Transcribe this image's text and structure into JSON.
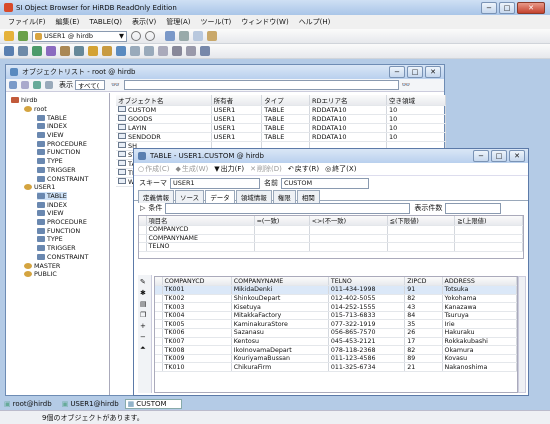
{
  "app": {
    "title": "SI Object Browser for HiRDB ReadOnly Edition"
  },
  "menu": [
    "ファイル(F)",
    "編集(E)",
    "TABLE(Q)",
    "表示(V)",
    "管理(A)",
    "ツール(T)",
    "ウィンドウ(W)",
    "ヘルプ(H)"
  ],
  "toolbar": {
    "connection": "USER1 @ hirdb"
  },
  "objwin": {
    "title": "オブジェクトリスト - root @ hirdb",
    "display_label": "表示",
    "display_value": "すべて(",
    "tree": [
      {
        "label": "hirdb",
        "level": 0,
        "kind": "db"
      },
      {
        "label": "root",
        "level": 1,
        "kind": "user"
      },
      {
        "label": "TABLE",
        "level": 2,
        "kind": "folder"
      },
      {
        "label": "INDEX",
        "level": 2,
        "kind": "folder"
      },
      {
        "label": "VIEW",
        "level": 2,
        "kind": "folder"
      },
      {
        "label": "PROCEDURE",
        "level": 2,
        "kind": "folder"
      },
      {
        "label": "FUNCTION",
        "level": 2,
        "kind": "folder"
      },
      {
        "label": "TYPE",
        "level": 2,
        "kind": "folder"
      },
      {
        "label": "TRIGGER",
        "level": 2,
        "kind": "folder"
      },
      {
        "label": "CONSTRAINT",
        "level": 2,
        "kind": "folder"
      },
      {
        "label": "USER1",
        "level": 1,
        "kind": "user"
      },
      {
        "label": "TABLE",
        "level": 2,
        "kind": "folder",
        "selected": true
      },
      {
        "label": "INDEX",
        "level": 2,
        "kind": "folder"
      },
      {
        "label": "VIEW",
        "level": 2,
        "kind": "folder"
      },
      {
        "label": "PROCEDURE",
        "level": 2,
        "kind": "folder"
      },
      {
        "label": "FUNCTION",
        "level": 2,
        "kind": "folder"
      },
      {
        "label": "TYPE",
        "level": 2,
        "kind": "folder"
      },
      {
        "label": "TRIGGER",
        "level": 2,
        "kind": "folder"
      },
      {
        "label": "CONSTRAINT",
        "level": 2,
        "kind": "folder"
      },
      {
        "label": "MASTER",
        "level": 1,
        "kind": "user"
      },
      {
        "label": "PUBLIC",
        "level": 1,
        "kind": "user"
      }
    ],
    "columns": [
      "オブジェクト名",
      "所有者",
      "タイプ",
      "RDエリア名",
      "空き領域"
    ],
    "rows": [
      [
        "CUSTOM",
        "USER1",
        "TABLE",
        "RDDATA10",
        "10"
      ],
      [
        "GOODS",
        "USER1",
        "TABLE",
        "RDDATA10",
        "10"
      ],
      [
        "LAYIN",
        "USER1",
        "TABLE",
        "RDDATA10",
        "10"
      ],
      [
        "SENDODR",
        "USER1",
        "TABLE",
        "RDDATA10",
        "10"
      ],
      [
        "SH",
        "",
        "",
        "",
        ""
      ],
      [
        "ST",
        "",
        "",
        "",
        ""
      ],
      [
        "TA",
        "",
        "",
        "",
        ""
      ],
      [
        "TE",
        "",
        "",
        "",
        ""
      ],
      [
        "WA",
        "",
        "",
        "",
        ""
      ]
    ]
  },
  "tablewin": {
    "title": "TABLE - USER1.CUSTOM @ hirdb",
    "tools": [
      "作成(C)",
      "生成(W)",
      "出力(F)",
      "削除(D)",
      "戻す(R)",
      "終了(X)"
    ],
    "schema_label": "スキーマ",
    "schema": "USER1",
    "name_label": "名前",
    "name": "CUSTOM",
    "tabs": [
      "定義情報",
      "ソース",
      "データ",
      "領域情報",
      "権限",
      "相関"
    ],
    "cond_label": "条件",
    "count_label": "表示件数",
    "filter_cols": [
      "項目名",
      "=(一致)",
      "<>(不一致)",
      "≦(下限値)",
      "≧(上限値)"
    ],
    "filter_rows": [
      "COMPANYCD",
      "COMPANYNAME",
      "TELNO"
    ],
    "data_cols": [
      "COMPANYCD",
      "COMPANYNAME",
      "TELNO",
      "ZIPCD",
      "ADDRESS"
    ],
    "data_rows": [
      [
        "TK001",
        "MikidaDenki",
        "011-434-1998",
        "91",
        "Totsuka"
      ],
      [
        "TK002",
        "ShinkouDepart",
        "012-402-5055",
        "82",
        "Yokohama"
      ],
      [
        "TK003",
        "Kisetuya",
        "014-252-1555",
        "43",
        "Kanazawa"
      ],
      [
        "TK004",
        "MitakkaFactory",
        "015-713-6833",
        "84",
        "Tsuruya"
      ],
      [
        "TK005",
        "KaminakuraStore",
        "077-322-1919",
        "35",
        "Irie"
      ],
      [
        "TK006",
        "Sazanasu",
        "056-865-7570",
        "26",
        "Hakuraku"
      ],
      [
        "TK007",
        "Kentosu",
        "045-453-2121",
        "17",
        "Rokkakubashi"
      ],
      [
        "TK008",
        "IkoInovamaDepart",
        "078-118-2368",
        "82",
        "Okamura"
      ],
      [
        "TK009",
        "KouriyamaBussan",
        "011-123-4586",
        "89",
        "Kovasu"
      ],
      [
        "TK010",
        "ChikuraFirm",
        "011-325-6734",
        "21",
        "Nakanoshima"
      ]
    ]
  },
  "taskbar": [
    "root@hirdb",
    "USER1@hirdb",
    "CUSTOM"
  ],
  "status": "9個のオブジェクトがあります。"
}
